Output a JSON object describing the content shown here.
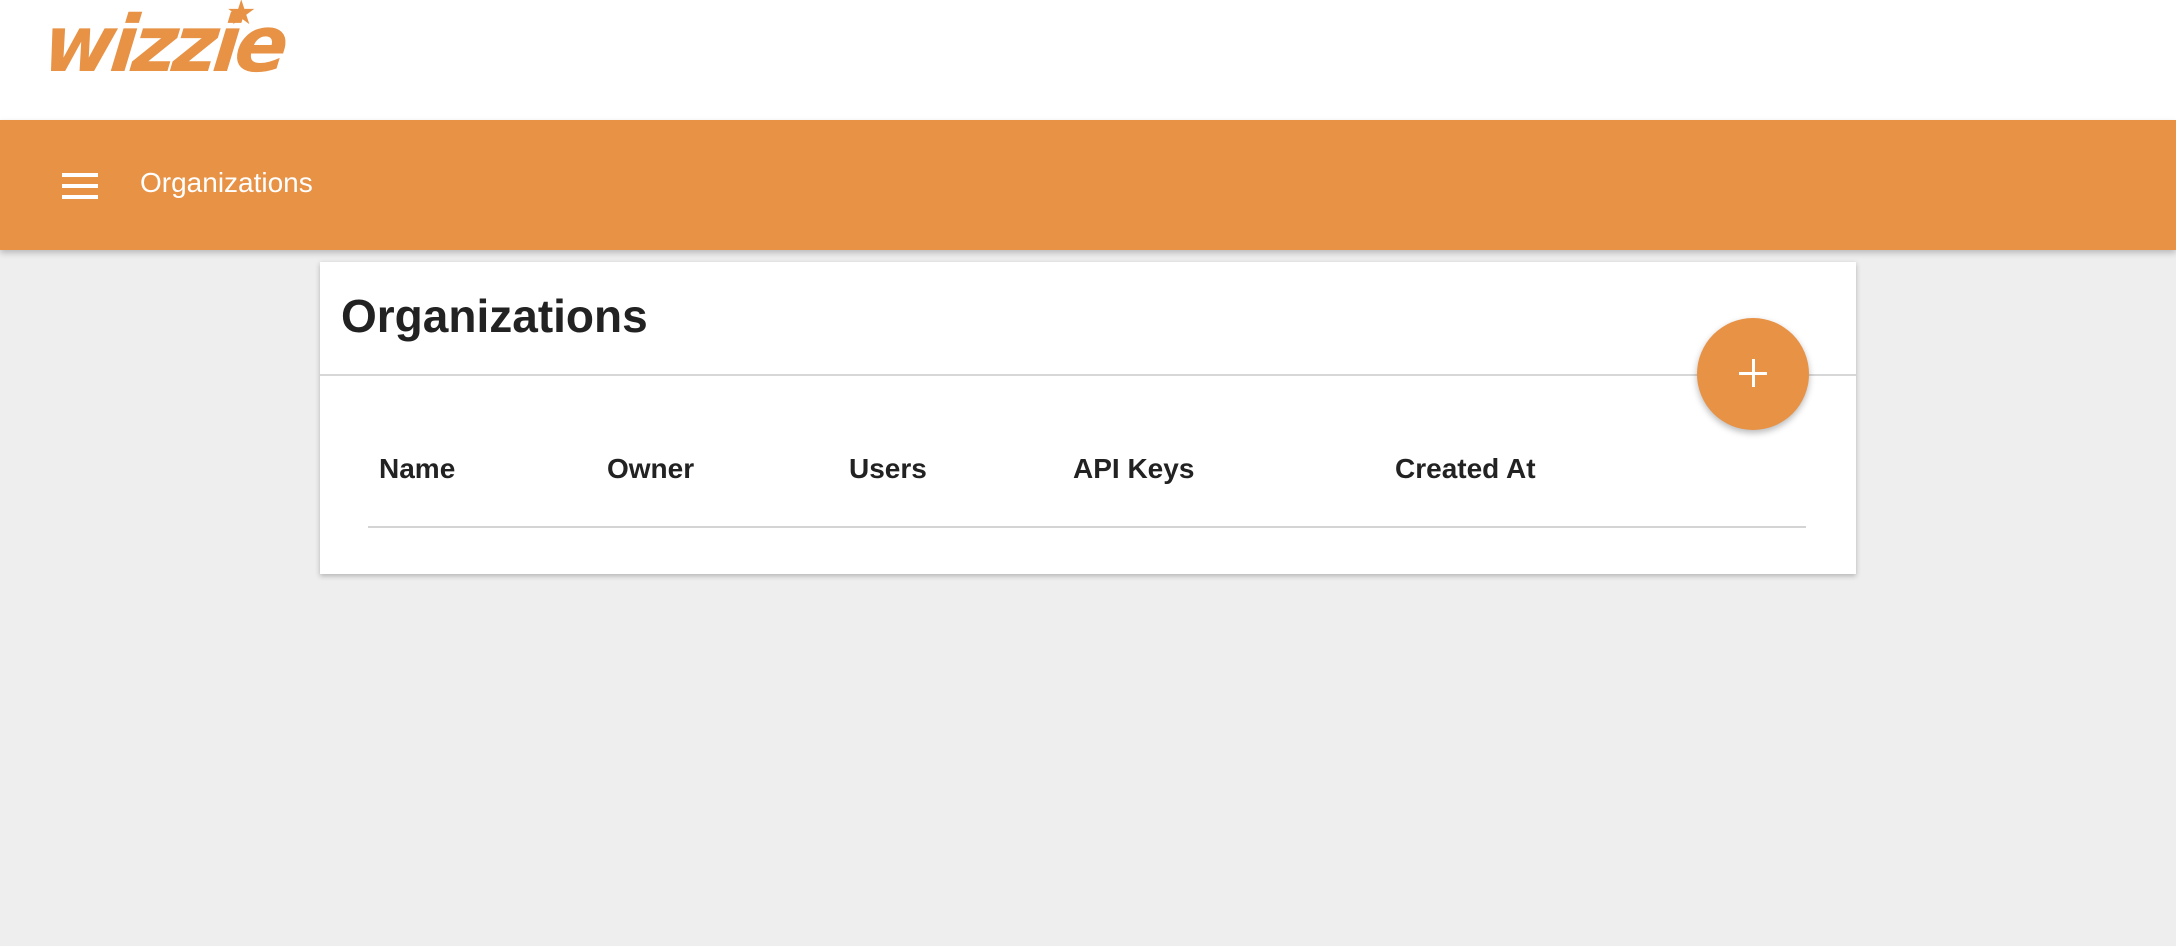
{
  "brand": {
    "logo_text": "wizzie",
    "logo_star": "★",
    "accent_color": "#e89246"
  },
  "app_bar": {
    "menu_icon": "hamburger-menu-icon",
    "title": "Organizations"
  },
  "page": {
    "heading": "Organizations",
    "add_button_label": "+",
    "add_button_icon": "plus-icon"
  },
  "table": {
    "columns": [
      "Name",
      "Owner",
      "Users",
      "API Keys",
      "Created At"
    ],
    "rows": []
  }
}
